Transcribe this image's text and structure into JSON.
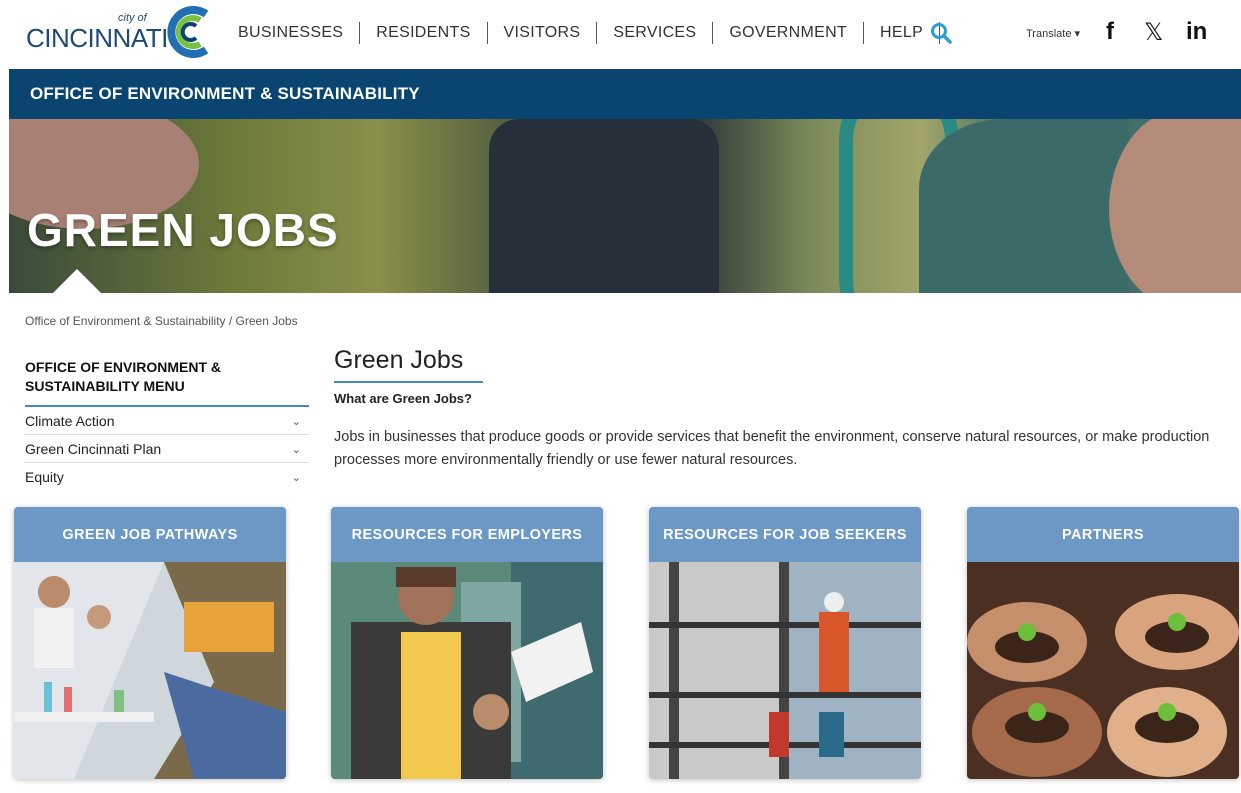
{
  "header": {
    "logo_city_of": "city of",
    "logo_name": "CINCINNATI",
    "nav": [
      "BUSINESSES",
      "RESIDENTS",
      "VISITORS",
      "SERVICES",
      "GOVERNMENT",
      "HELP"
    ],
    "translate_label": "Translate ▾",
    "social": {
      "facebook": "f",
      "x": "𝕏",
      "linkedin": "in"
    }
  },
  "dept_bar": {
    "title": "OFFICE OF ENVIRONMENT & SUSTAINABILITY"
  },
  "hero": {
    "title": "GREEN JOBS"
  },
  "breadcrumb": "Office of Environment & Sustainability   / Green Jobs",
  "side_menu": {
    "heading": "OFFICE OF ENVIRONMENT & SUSTAINABILITY MENU",
    "items": [
      {
        "label": "Climate Action"
      },
      {
        "label": "Green Cincinnati Plan"
      },
      {
        "label": "Equity"
      }
    ]
  },
  "main": {
    "title": "Green Jobs",
    "subtitle": "What are Green Jobs?",
    "body": "Jobs in businesses that produce goods or provide services that benefit the environment, conserve natural resources, or make production processes more environmentally friendly or use fewer natural resources."
  },
  "cards": [
    {
      "label": "GREEN JOB PATHWAYS"
    },
    {
      "label": "RESOURCES FOR EMPLOYERS"
    },
    {
      "label": "RESOURCES FOR JOB SEEKERS"
    },
    {
      "label": "PARTNERS"
    }
  ],
  "colors": {
    "brand_blue": "#0a4470",
    "accent_blue": "#3f8fc2",
    "card_header": "#6b98c4",
    "search_icon": "#2a9fd6"
  }
}
